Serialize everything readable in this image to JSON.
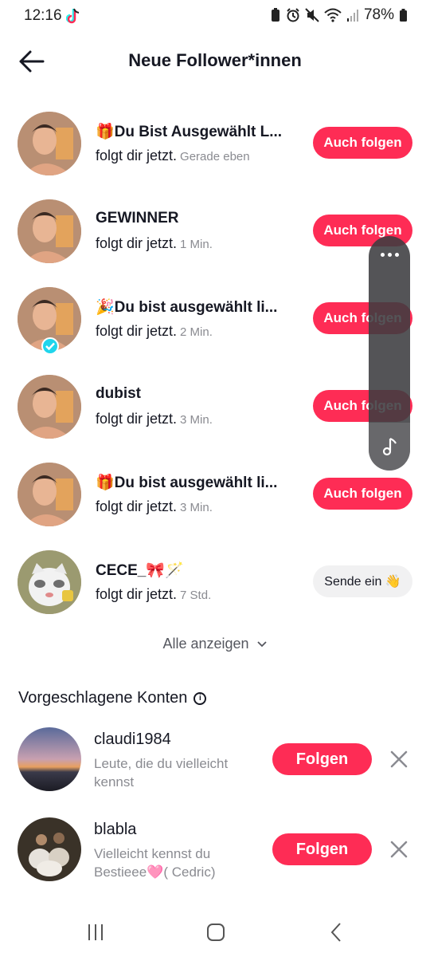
{
  "status_bar": {
    "time": "12:16",
    "battery": "78%"
  },
  "header": {
    "title": "Neue Follower*innen"
  },
  "followers": [
    {
      "name": "🎁Du Bist Ausgewählt L...",
      "action": "folgt dir jetzt.",
      "time": "Gerade eben",
      "button": "Auch folgen",
      "verified": false
    },
    {
      "name": "GEWINNER",
      "action": "folgt dir jetzt.",
      "time": "1 Min.",
      "button": "Auch folgen",
      "verified": false
    },
    {
      "name": "🎉Du bist ausgewählt li...",
      "action": "folgt dir jetzt.",
      "time": "2 Min.",
      "button": "Auch folgen",
      "verified": true
    },
    {
      "name": "dubist",
      "action": "folgt dir jetzt.",
      "time": "3 Min.",
      "button": "Auch folgen",
      "verified": false
    },
    {
      "name": "🎁Du bist ausgewählt li...",
      "action": "folgt dir jetzt.",
      "time": "3 Min.",
      "button": "Auch folgen",
      "verified": false
    },
    {
      "name": "CECE_🎀🪄",
      "action": "folgt dir jetzt.",
      "time": "7 Std.",
      "button": "Sende ein 👋",
      "verified": false
    }
  ],
  "show_all": "Alle anzeigen",
  "suggested": {
    "title": "Vorgeschlagene Konten",
    "accounts": [
      {
        "name": "claudi1984",
        "reason": "Leute, die du vielleicht kennst",
        "button": "Folgen"
      },
      {
        "name": "blabla",
        "reason": "Vielleicht kennst du Bestieee🩷( Cedric)",
        "button": "Folgen"
      }
    ]
  },
  "colors": {
    "accent": "#fe2c55",
    "muted_text": "#8a8b91",
    "verified": "#20d5ec"
  }
}
